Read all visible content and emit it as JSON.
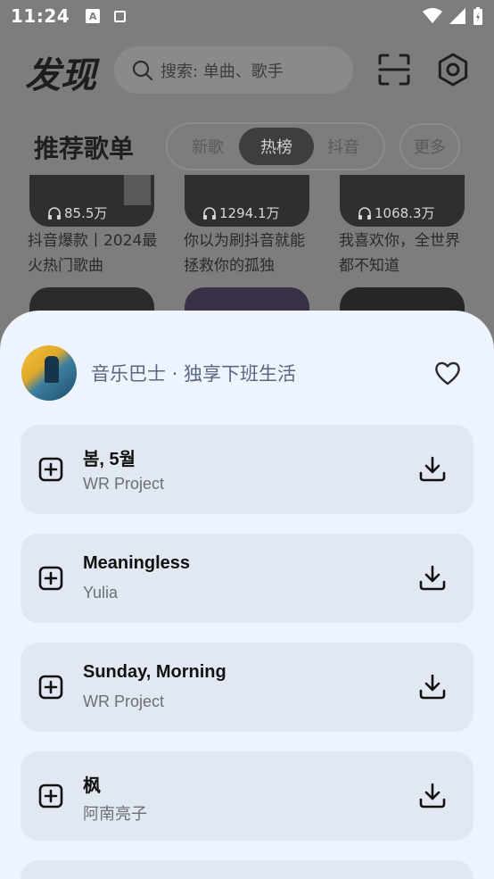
{
  "status_bar": {
    "time": "11:24",
    "notif_a": "A"
  },
  "header": {
    "title": "发现",
    "search_placeholder": "搜索: 单曲、歌手"
  },
  "section": {
    "title": "推荐歌单",
    "tabs": [
      {
        "label": "新歌",
        "active": false
      },
      {
        "label": "热榜",
        "active": true
      },
      {
        "label": "抖音",
        "active": false
      }
    ],
    "more_label": "更多"
  },
  "playlists": [
    {
      "plays": "85.5万",
      "title": "抖音爆款丨2024最火热门歌曲"
    },
    {
      "plays": "1294.1万",
      "title": "你以为刷抖音就能拯救你的孤独"
    },
    {
      "plays": "1068.3万",
      "title": "我喜欢你，全世界都不知道"
    }
  ],
  "sheet": {
    "title": "音乐巴士 · 独享下班生活",
    "songs": [
      {
        "name": "봄, 5월",
        "artist": "WR Project"
      },
      {
        "name": "Meaningless",
        "artist": "Yulia"
      },
      {
        "name": "Sunday, Morning",
        "artist": "WR Project"
      },
      {
        "name": "枫",
        "artist": "阿南亮子"
      }
    ]
  },
  "colors": {
    "sheet_bg": "#eef4fd",
    "row_bg": "#e2e8f1",
    "scrim": "#7d7d7d"
  }
}
